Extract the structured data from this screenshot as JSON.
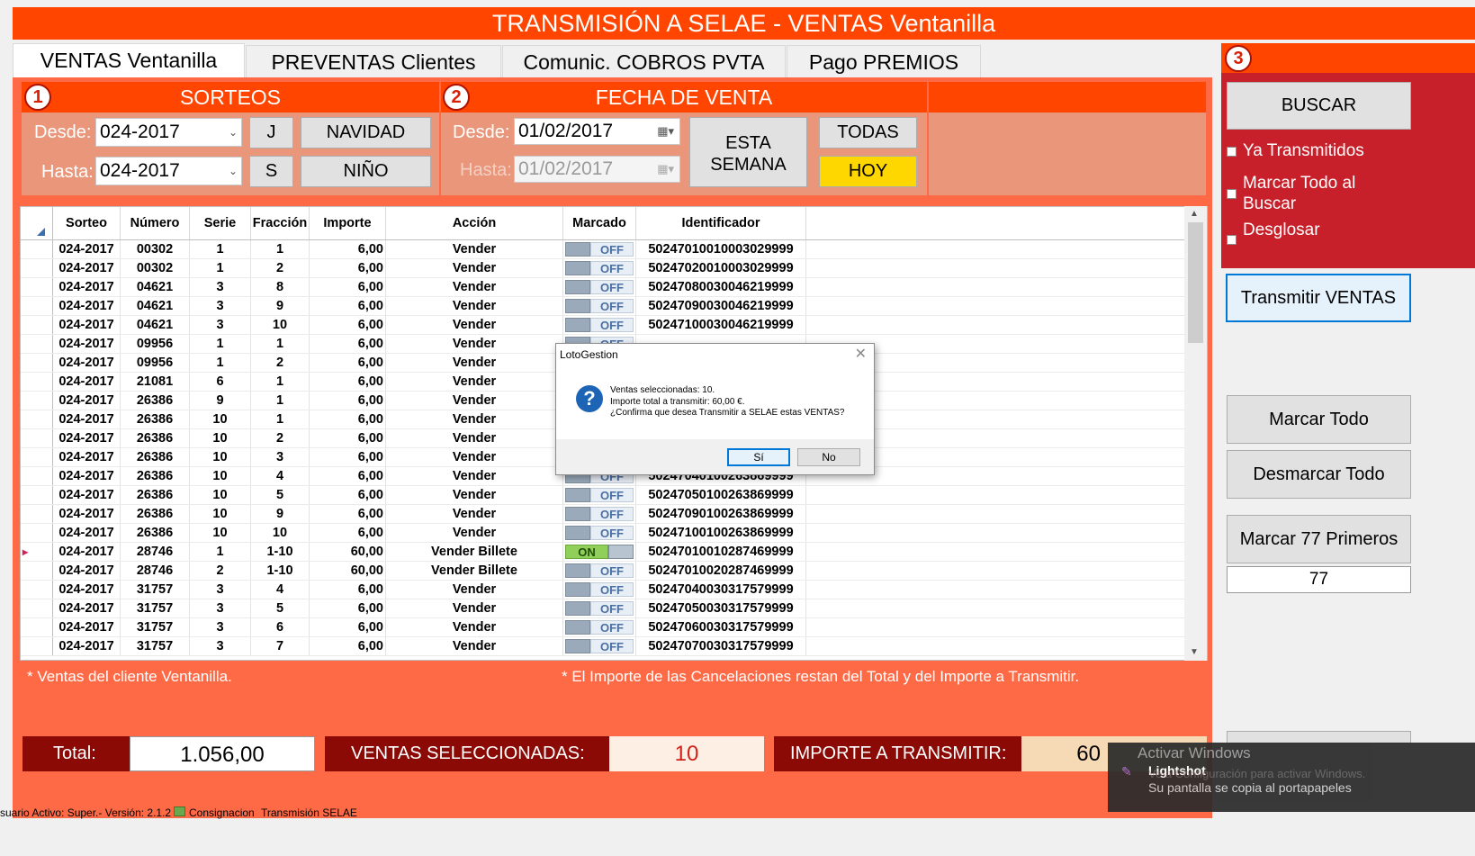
{
  "title": "TRANSMISIÓN A SELAE - VENTAS Ventanilla",
  "tabs": [
    "VENTAS Ventanilla",
    "PREVENTAS Clientes",
    "Comunic. COBROS PVTA",
    "Pago PREMIOS"
  ],
  "sorteos": {
    "number": "1",
    "header": "SORTEOS",
    "desde_label": "Desde:",
    "desde_value": "024-2017",
    "hasta_label": "Hasta:",
    "hasta_value": "024-2017",
    "btn_j": "J",
    "btn_s": "S",
    "btn_navidad": "NAVIDAD",
    "btn_nino": "NIÑO"
  },
  "fecha": {
    "number": "2",
    "header": "FECHA DE VENTA",
    "desde_label": "Desde:",
    "desde_value": "01/02/2017",
    "hasta_label": "Hasta:",
    "hasta_value": "01/02/2017",
    "btn_esta": "ESTA",
    "btn_semana": "SEMANA",
    "btn_todas": "TODAS",
    "btn_hoy": "HOY"
  },
  "grid": {
    "columns": [
      "Sorteo",
      "Número",
      "Serie",
      "Fracción",
      "Importe",
      "Acción",
      "Marcado",
      "Identificador"
    ],
    "rows": [
      [
        "024-2017",
        "00302",
        "1",
        "1",
        "6,00",
        "Vender",
        "OFF",
        "50247010010003029999"
      ],
      [
        "024-2017",
        "00302",
        "1",
        "2",
        "6,00",
        "Vender",
        "OFF",
        "50247020010003029999"
      ],
      [
        "024-2017",
        "04621",
        "3",
        "8",
        "6,00",
        "Vender",
        "OFF",
        "50247080030046219999"
      ],
      [
        "024-2017",
        "04621",
        "3",
        "9",
        "6,00",
        "Vender",
        "OFF",
        "50247090030046219999"
      ],
      [
        "024-2017",
        "04621",
        "3",
        "10",
        "6,00",
        "Vender",
        "OFF",
        "50247100030046219999"
      ],
      [
        "024-2017",
        "09956",
        "1",
        "1",
        "6,00",
        "Vender",
        "OFF",
        ""
      ],
      [
        "024-2017",
        "09956",
        "1",
        "2",
        "6,00",
        "Vender",
        "",
        ""
      ],
      [
        "024-2017",
        "21081",
        "6",
        "1",
        "6,00",
        "Vender",
        "",
        ""
      ],
      [
        "024-2017",
        "26386",
        "9",
        "1",
        "6,00",
        "Vender",
        "",
        ""
      ],
      [
        "024-2017",
        "26386",
        "10",
        "1",
        "6,00",
        "Vender",
        "",
        ""
      ],
      [
        "024-2017",
        "26386",
        "10",
        "2",
        "6,00",
        "Vender",
        "",
        ""
      ],
      [
        "024-2017",
        "26386",
        "10",
        "3",
        "6,00",
        "Vender",
        "",
        ""
      ],
      [
        "024-2017",
        "26386",
        "10",
        "4",
        "6,00",
        "Vender",
        "OFF",
        "50247040100263869999"
      ],
      [
        "024-2017",
        "26386",
        "10",
        "5",
        "6,00",
        "Vender",
        "OFF",
        "50247050100263869999"
      ],
      [
        "024-2017",
        "26386",
        "10",
        "9",
        "6,00",
        "Vender",
        "OFF",
        "50247090100263869999"
      ],
      [
        "024-2017",
        "26386",
        "10",
        "10",
        "6,00",
        "Vender",
        "OFF",
        "50247100100263869999"
      ],
      [
        "024-2017",
        "28746",
        "1",
        "1-10",
        "60,00",
        "Vender Billete",
        "ON",
        "50247010010287469999"
      ],
      [
        "024-2017",
        "28746",
        "2",
        "1-10",
        "60,00",
        "Vender Billete",
        "OFF",
        "50247010020287469999"
      ],
      [
        "024-2017",
        "31757",
        "3",
        "4",
        "6,00",
        "Vender",
        "OFF",
        "50247040030317579999"
      ],
      [
        "024-2017",
        "31757",
        "3",
        "5",
        "6,00",
        "Vender",
        "OFF",
        "50247050030317579999"
      ],
      [
        "024-2017",
        "31757",
        "3",
        "6",
        "6,00",
        "Vender",
        "OFF",
        "50247060030317579999"
      ],
      [
        "024-2017",
        "31757",
        "3",
        "7",
        "6,00",
        "Vender",
        "OFF",
        "50247070030317579999"
      ]
    ]
  },
  "notes": {
    "left": "* Ventas del cliente Ventanilla.",
    "right": "* El Importe de las Cancelaciones restan del Total y del Importe a Transmitir."
  },
  "totals": {
    "total_label": "Total:",
    "total_value": "1.056,00",
    "selected_label": "VENTAS SELECCIONADAS:",
    "selected_value": "10",
    "import_label": "IMPORTE A TRANSMITIR:",
    "import_value": "60"
  },
  "right": {
    "number": "3",
    "buscar": "BUSCAR",
    "chk_ya": "Ya Transmitidos",
    "chk_marcar_1": "Marcar Todo al",
    "chk_marcar_2": "Buscar",
    "chk_desglosar": "Desglosar",
    "transmitir": "Transmitir VENTAS",
    "marcar_todo": "Marcar Todo",
    "desmarcar_todo": "Desmarcar Todo",
    "marcar_77": "Marcar 77 Primeros",
    "count_value": "77"
  },
  "dialog": {
    "title": "LotoGestion",
    "line1": "Ventas seleccionadas: 10.",
    "line2": "Importe total a transmitir: 60,00 €.",
    "line3": "¿Confirma que desea Transmitir a SELAE estas VENTAS?",
    "yes": "Sí",
    "no": "No"
  },
  "status": {
    "user": "suario Activo: Super.- Versión: 2.1.2 -",
    "item1": "Consignacion",
    "item2": "Transmisión SELAE"
  },
  "toast": {
    "line1": "Activar Windows",
    "app": "Lightshot",
    "line2": "Ve a Configuración para activar Windows.",
    "line3": "Su pantalla se copia al portapapeles"
  }
}
